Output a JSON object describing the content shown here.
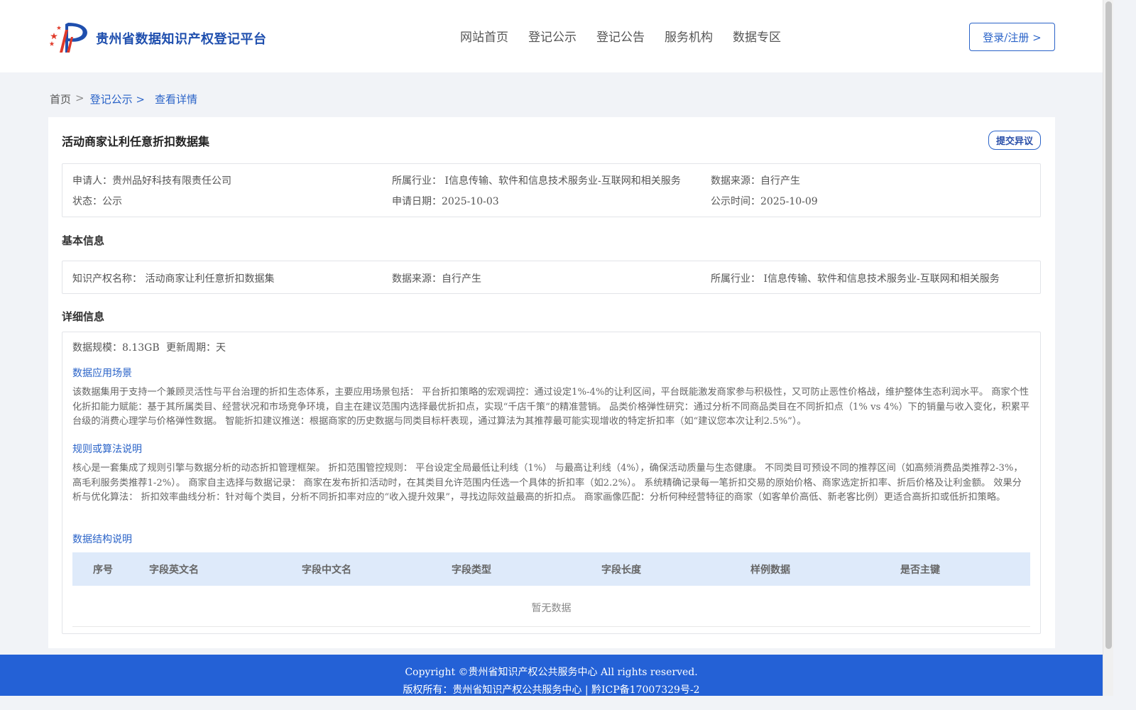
{
  "header": {
    "site_title": "贵州省数据知识产权登记平台",
    "nav": [
      "网站首页",
      "登记公示",
      "登记公告",
      "服务机构",
      "数据专区"
    ],
    "login_label": "登录/注册 >"
  },
  "breadcrumb": {
    "home": "首页",
    "sep": ">",
    "items": [
      "登记公示 >",
      "查看详情"
    ]
  },
  "detail": {
    "title": "活动商家让利任意折扣数据集",
    "objection_label": "提交异议",
    "summary": {
      "applicant": "申请人：贵州品好科技有限责任公司",
      "industry": "所属行业： I信息传输、软件和信息技术服务业-互联网和相关服务",
      "source": "数据来源：自行产生",
      "status": "状态：公示",
      "apply_date": "申请日期：2025-10-03",
      "publish_date": "公示时间：2025-10-09"
    },
    "basic_title": "基本信息",
    "basic": {
      "ip_name": "知识产权名称： 活动商家让利任意折扣数据集",
      "source": "数据来源：自行产生",
      "industry": "所属行业： I信息传输、软件和信息技术服务业-互联网和相关服务"
    },
    "detail_title": "详细信息",
    "scale": "数据规模：8.13GB",
    "cycle": "更新周期：天",
    "scenario_title": "数据应用场景",
    "scenario_text": "该数据集用于支持一个兼顾灵活性与平台治理的折扣生态体系，主要应用场景包括： 平台折扣策略的宏观调控：通过设定1%-4%的让利区间，平台既能激发商家参与积极性，又可防止恶性价格战，维护整体生态利润水平。 商家个性化折扣能力赋能：基于其所属类目、经营状况和市场竞争环境，自主在建议范围内选择最优折扣点，实现“千店千策”的精准营销。 品类价格弹性研究：通过分析不同商品类目在不同折扣点（1% vs 4%）下的销量与收入变化，积累平台级的消费心理学与价格弹性数据。 智能折扣建议推送：根据商家的历史数据与同类目标杆表现，通过算法为其推荐最可能实现增收的特定折扣率（如“建议您本次让利2.5%”）。",
    "rule_title": "规则或算法说明",
    "rule_text": "核心是一套集成了规则引擎与数据分析的动态折扣管理框架。 折扣范围管控规则： 平台设定全局最低让利线（1%） 与最高让利线（4%），确保活动质量与生态健康。 不同类目可预设不同的推荐区间（如高频消费品类推荐2-3%，高毛利服务类推荐1-2%）。 商家自主选择与数据记录： 商家在发布折扣活动时，在其类目允许范围内任选一个具体的折扣率（如2.2%）。 系统精确记录每一笔折扣交易的原始价格、商家选定折扣率、折后价格及让利金额。 效果分析与优化算法： 折扣效率曲线分析：针对每个类目，分析不同折扣率对应的“收入提升效果”，寻找边际效益最高的折扣点。 商家画像匹配：分析何种经营特征的商家（如客单价高低、新老客比例）更适合高折扣或低折扣策略。",
    "structure_title": "数据结构说明",
    "table_headers": [
      "序号",
      "字段英文名",
      "字段中文名",
      "字段类型",
      "字段长度",
      "样例数据",
      "是否主键"
    ],
    "empty_text": "暂无数据"
  },
  "footer": {
    "copyright": "Copyright ©贵州省知识产权公共服务中心 All rights reserved.",
    "owner": "版权所有：贵州省知识产权公共服务中心 | 黔ICP备17007329号-2"
  },
  "colors": {
    "accent": "#2a63c8",
    "footer_bg": "#2461d6",
    "table_head_bg": "#deeafa"
  }
}
